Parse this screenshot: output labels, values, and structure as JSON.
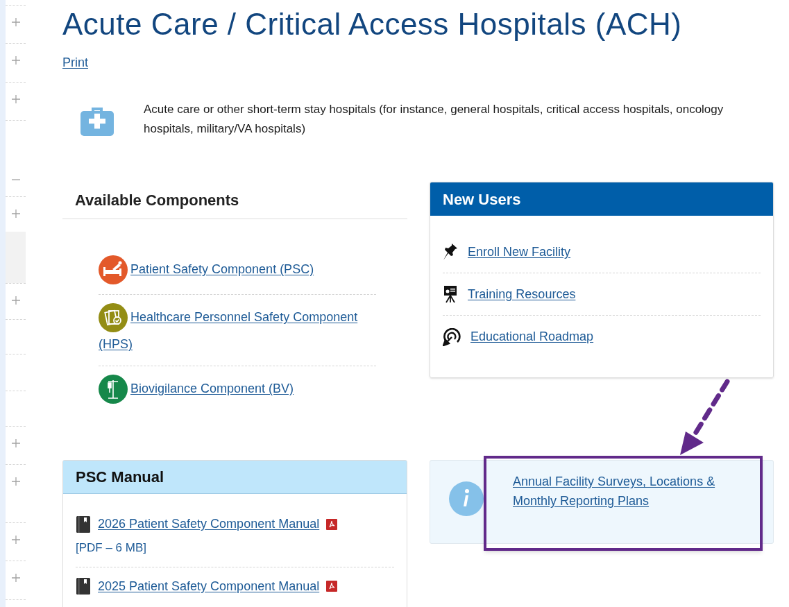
{
  "gutter": [
    {
      "kind": "toggle",
      "expanded": false
    },
    {
      "kind": "toggle",
      "expanded": false
    },
    {
      "kind": "toggle",
      "expanded": false
    },
    {
      "kind": "toggle",
      "expanded": true
    },
    {
      "kind": "toggle",
      "expanded": false
    },
    {
      "kind": "shaded"
    },
    {
      "kind": "toggle",
      "expanded": false
    },
    {
      "kind": "blank"
    },
    {
      "kind": "blank"
    },
    {
      "kind": "blank"
    },
    {
      "kind": "toggle",
      "expanded": false
    },
    {
      "kind": "toggle",
      "expanded": false
    },
    {
      "kind": "toggle",
      "expanded": false
    },
    {
      "kind": "toggle",
      "expanded": false
    }
  ],
  "page": {
    "title": "Acute Care / Critical Access Hospitals (ACH)",
    "print_link": "Print",
    "description": "Acute care or other short-term stay hospitals (for instance, general hospitals, critical access hospitals, oncology hospitals, military/VA hospitals)"
  },
  "available_components": {
    "heading": "Available Components",
    "items": [
      {
        "kind": "bed",
        "label": "Patient Safety Component (PSC)"
      },
      {
        "kind": "clipboard",
        "label": "Healthcare Personnel Safety Component (HPS)"
      },
      {
        "kind": "iv",
        "label": "Biovigilance Component (BV)"
      }
    ]
  },
  "new_users": {
    "heading": "New Users",
    "items": [
      {
        "kind": "pin",
        "label": "Enroll New Facility"
      },
      {
        "kind": "easel",
        "label": "Training Resources"
      },
      {
        "kind": "target",
        "label": "Educational Roadmap"
      }
    ]
  },
  "psc_manual": {
    "heading": "PSC Manual",
    "items": [
      {
        "label": "2026 Patient Safety Component Manual",
        "size": "[PDF – 6 MB]"
      },
      {
        "label": "2025 Patient Safety Component Manual"
      }
    ]
  },
  "info_card": {
    "link": "Annual Facility Surveys, Locations & Monthly Reporting Plans"
  }
}
